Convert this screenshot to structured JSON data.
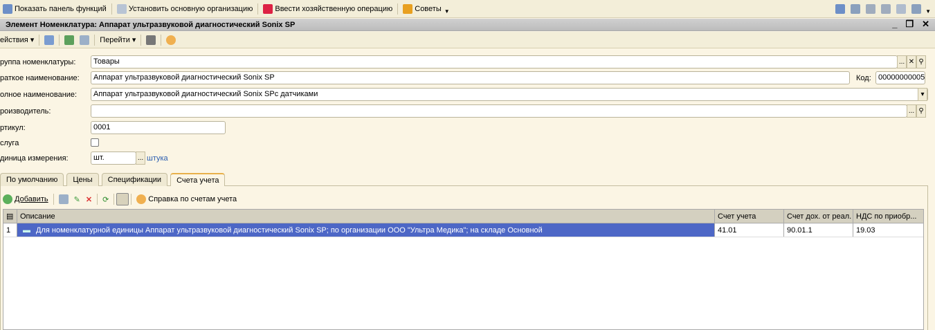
{
  "topbar": {
    "items": [
      {
        "label": "Показать панель функций",
        "icon": "function-panel-icon"
      },
      {
        "label": "Установить основную организацию",
        "icon": "organization-icon"
      },
      {
        "label": "Ввести хозяйственную операцию",
        "icon": "dt-kt-icon"
      },
      {
        "label": "Советы",
        "icon": "tips-icon"
      }
    ]
  },
  "window": {
    "title": "Элемент Номенклатура: Аппарат ультразвуковой диагностический Sonix SP"
  },
  "formbar": {
    "actions": "ействия",
    "goto": "Перейти"
  },
  "fields": {
    "group_label": "руппа номенклатуры:",
    "group_value": "Товары",
    "short_label": "раткое наименование:",
    "short_value": "Аппарат ультразвуковой диагностический Sonix SP",
    "code_label": "Код:",
    "code_value": "00000000005",
    "full_label": "олное наименование:",
    "full_value": "Аппарат ультразвуковой диагностический Sonix SPc датчиками",
    "maker_label": "роизводитель:",
    "maker_value": "",
    "article_label": "ртикул:",
    "article_value": "0001",
    "service_label": "слуга",
    "unit_label": "диница измерения:",
    "unit_value": "шт.",
    "unit_full": "штука"
  },
  "tabs": [
    "По умолчанию",
    "Цены",
    "Спецификации",
    "Счета учета"
  ],
  "gridbar": {
    "add": "Добавить",
    "help": "Справка по счетам учета"
  },
  "grid": {
    "columns": [
      "Описание",
      "Счет учета",
      "Счет дох. от реал.",
      "НДС по приобр..."
    ],
    "rows": [
      {
        "n": "1",
        "desc": "Для номенклатурной единицы Аппарат ультразвуковой диагностический Sonix SP; по организации ООО \"Ультра Медика\"; на складе Основной",
        "acc": "41.01",
        "income": "90.01.1",
        "vat": "19.03"
      }
    ]
  }
}
